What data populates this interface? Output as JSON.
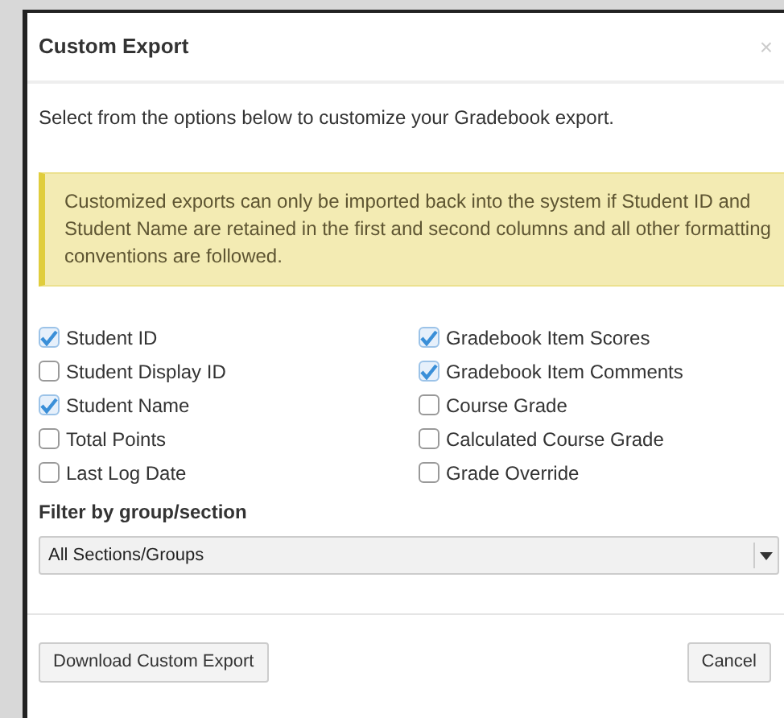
{
  "dialog": {
    "title": "Custom Export",
    "close": "×"
  },
  "intro": "Select from the options below to customize your Gradebook export.",
  "alert": "Customized exports can only be imported back into the system if Student ID and Student Name are retained in the first and second columns and all other formatting conventions are followed.",
  "options_left": [
    {
      "label": "Student ID",
      "checked": true
    },
    {
      "label": "Student Display ID",
      "checked": false
    },
    {
      "label": "Student Name",
      "checked": true
    },
    {
      "label": "Total Points",
      "checked": false
    },
    {
      "label": "Last Log Date",
      "checked": false
    }
  ],
  "options_right": [
    {
      "label": "Gradebook Item Scores",
      "checked": true
    },
    {
      "label": "Gradebook Item Comments",
      "checked": true
    },
    {
      "label": "Course Grade",
      "checked": false
    },
    {
      "label": "Calculated Course Grade",
      "checked": false
    },
    {
      "label": "Grade Override",
      "checked": false
    }
  ],
  "filter": {
    "label": "Filter by group/section",
    "value": "All Sections/Groups"
  },
  "buttons": {
    "primary": "Download Custom Export",
    "cancel": "Cancel"
  }
}
